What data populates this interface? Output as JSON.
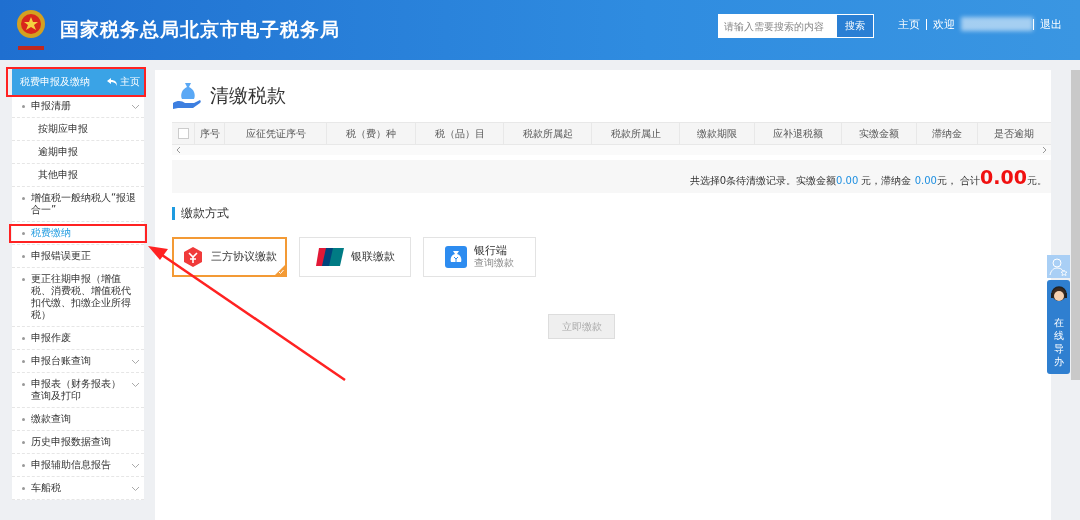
{
  "header": {
    "title": "国家税务总局北京市电子税务局",
    "search": {
      "placeholder": "请输入需要搜索的内容",
      "button": "搜索"
    },
    "links": [
      {
        "label": "主页"
      },
      {
        "label": "欢迎"
      },
      {
        "label": "退出"
      }
    ]
  },
  "sidebar": {
    "title": "税费申报及缴纳",
    "home": "主页",
    "items": [
      {
        "label": "申报清册",
        "expandable": true,
        "selected": false,
        "children": [
          {
            "label": "按期应申报"
          },
          {
            "label": "逾期申报"
          },
          {
            "label": "其他申报"
          }
        ]
      },
      {
        "label": "增值税一般纳税人“报退合一”",
        "expandable": false,
        "selected": false
      },
      {
        "label": "税费缴纳",
        "expandable": false,
        "selected": true
      },
      {
        "label": "申报错误更正",
        "expandable": false,
        "selected": false
      },
      {
        "label": "更正往期申报（增值税、消费税、增值税代扣代缴、扣缴企业所得税）",
        "expandable": false,
        "selected": false
      },
      {
        "label": "申报作废",
        "expandable": false,
        "selected": false
      },
      {
        "label": "申报台账查询",
        "expandable": true,
        "selected": false
      },
      {
        "label": "申报表（财务报表）查询及打印",
        "expandable": true,
        "selected": false
      },
      {
        "label": "缴款查询",
        "expandable": false,
        "selected": false
      },
      {
        "label": "历史申报数据查询",
        "expandable": false,
        "selected": false
      },
      {
        "label": "申报辅助信息报告",
        "expandable": true,
        "selected": false
      },
      {
        "label": "车船税",
        "expandable": true,
        "selected": false
      }
    ]
  },
  "page": {
    "title": "清缴税款",
    "table": {
      "all_checked": false,
      "columns": [
        "序号",
        "应征凭证序号",
        "税（费）种",
        "税（品）目",
        "税款所属起",
        "税款所属止",
        "缴款期限",
        "应补退税额",
        "实缴金额",
        "滞纳金",
        "是否逾期"
      ]
    },
    "summary": {
      "prefix": "共选择0条待清缴记录。实缴金额",
      "paid": "0.00",
      "mid": " 元，滞纳金 ",
      "late_fee": "0.00",
      "total_label": "元， 合计",
      "total": "0.00",
      "suffix": "元。"
    },
    "payment_section": "缴款方式",
    "methods": [
      {
        "kind": "three-party",
        "label": "三方协议缴款",
        "selected": true
      },
      {
        "kind": "unionpay",
        "label": "银联缴款",
        "selected": false
      },
      {
        "kind": "bank",
        "label": "银行端",
        "sublabel": "查询缴款",
        "selected": false
      }
    ],
    "pay_button": {
      "label": "立即缴款",
      "disabled": true
    }
  },
  "assistant": {
    "label": "在线导办"
  }
}
